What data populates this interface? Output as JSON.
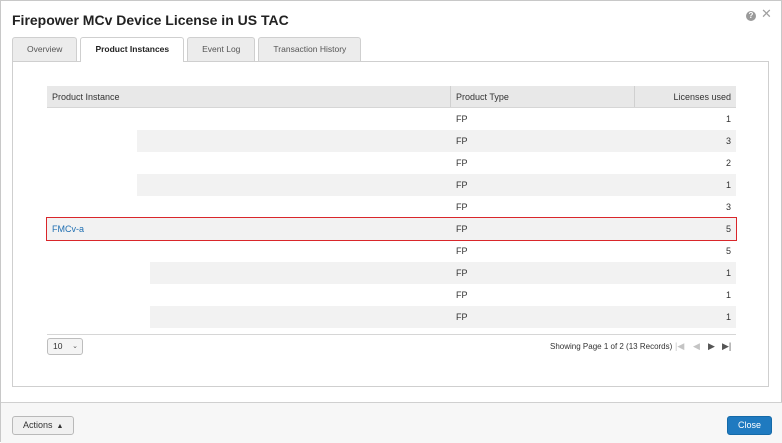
{
  "dialog": {
    "title": "Firepower MCv Device License in US TAC",
    "help_icon": "question-icon",
    "close_icon": "close-icon"
  },
  "tabs": [
    {
      "label": "Overview",
      "active": false
    },
    {
      "label": "Product Instances",
      "active": true
    },
    {
      "label": "Event Log",
      "active": false
    },
    {
      "label": "Transaction History",
      "active": false
    }
  ],
  "table": {
    "headers": {
      "product_instance": "Product Instance",
      "product_type": "Product Type",
      "licenses_used": "Licenses used"
    },
    "rows": [
      {
        "instance": "",
        "type": "FP",
        "used": "1"
      },
      {
        "instance": "",
        "type": "FP",
        "used": "3"
      },
      {
        "instance": "",
        "type": "FP",
        "used": "2"
      },
      {
        "instance": "",
        "type": "FP",
        "used": "1"
      },
      {
        "instance": "",
        "type": "FP",
        "used": "3"
      },
      {
        "instance": "FMCv-a",
        "type": "FP",
        "used": "5"
      },
      {
        "instance": "",
        "type": "FP",
        "used": "5"
      },
      {
        "instance": "",
        "type": "FP",
        "used": "1"
      },
      {
        "instance": "",
        "type": "FP",
        "used": "1"
      },
      {
        "instance": "",
        "type": "FP",
        "used": "1"
      }
    ],
    "selected_row": 5
  },
  "pagination": {
    "page_size": "10",
    "status": "Showing Page 1 of 2 (13 Records)",
    "first_icon": "first-page-icon",
    "prev_icon": "prev-page-icon",
    "next_icon": "next-page-icon",
    "last_icon": "last-page-icon"
  },
  "footer": {
    "actions_label": "Actions",
    "close_label": "Close"
  },
  "colors": {
    "accent": "#1f7ac0",
    "link": "#1f6fb2",
    "highlight": "#d9262a"
  }
}
